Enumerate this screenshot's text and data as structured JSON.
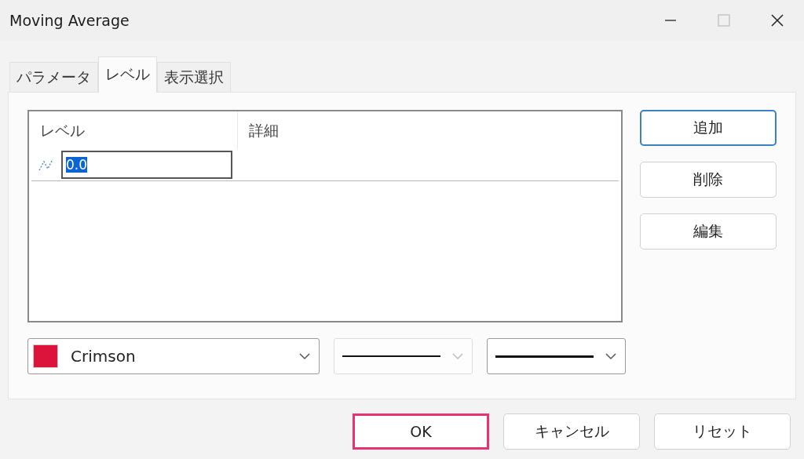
{
  "window": {
    "title": "Moving Average"
  },
  "tabs": [
    {
      "label": "パラメータ",
      "selected": false
    },
    {
      "label": "レベル",
      "selected": true
    },
    {
      "label": "表示選択",
      "selected": false
    }
  ],
  "levels_table": {
    "columns": [
      "レベル",
      "詳細"
    ],
    "rows": [
      {
        "value": "0.0",
        "editing": true
      }
    ]
  },
  "side_buttons": [
    {
      "label": "追加",
      "default": true
    },
    {
      "label": "削除",
      "default": false
    },
    {
      "label": "編集",
      "default": false
    }
  ],
  "combos": [
    {
      "kind": "color",
      "label": "Crimson",
      "color": "#dc143c",
      "disabled": false
    },
    {
      "kind": "line",
      "disabled": true
    },
    {
      "kind": "width",
      "disabled": false
    }
  ],
  "buttons": [
    {
      "label": "OK",
      "highlighted": true
    },
    {
      "label": "キャンセル",
      "highlighted": false
    },
    {
      "label": "リセット",
      "highlighted": false
    }
  ]
}
